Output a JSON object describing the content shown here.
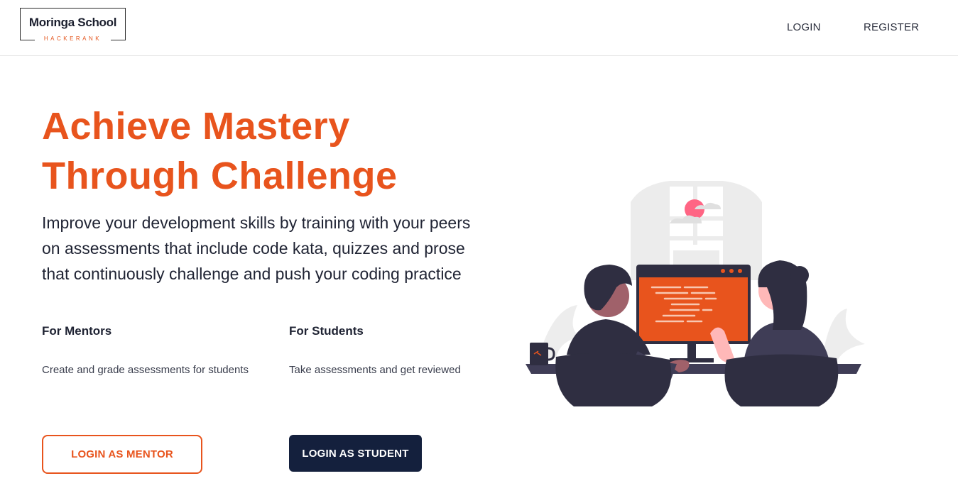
{
  "header": {
    "logo_name": "Moringa School",
    "logo_tagline": "HACKERANK",
    "login_label": "LOGIN",
    "register_label": "REGISTER"
  },
  "hero": {
    "title_line1": "Achieve Mastery",
    "title_line2": "Through Challenge",
    "description": "Improve your development skills by training with your peers on assessments that include code kata, quizzes and prose that continuously challenge and push your coding practice"
  },
  "mentors": {
    "heading": "For Mentors",
    "text": "Create and grade assessments for students",
    "button_label": "LOGIN AS MENTOR"
  },
  "students": {
    "heading": "For Students",
    "text": "Take assessments and get reviewed",
    "button_label": "LOGIN AS STUDENT"
  },
  "colors": {
    "accent": "#e8541d",
    "navy": "#14203d",
    "text": "#1f2333"
  }
}
